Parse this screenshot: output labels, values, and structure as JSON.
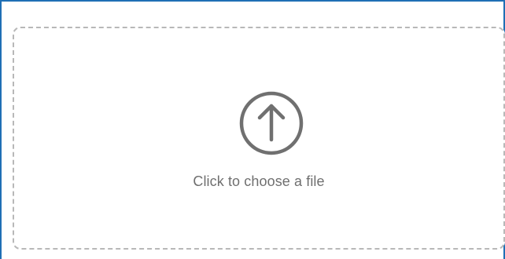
{
  "upload": {
    "label": "Click to choose a file",
    "icon": "arrow-up-circle-icon"
  },
  "colors": {
    "frame_border": "#1f6fb5",
    "dash_border": "#b8b8b8",
    "icon": "#707070",
    "label": "#6f6f6f"
  }
}
